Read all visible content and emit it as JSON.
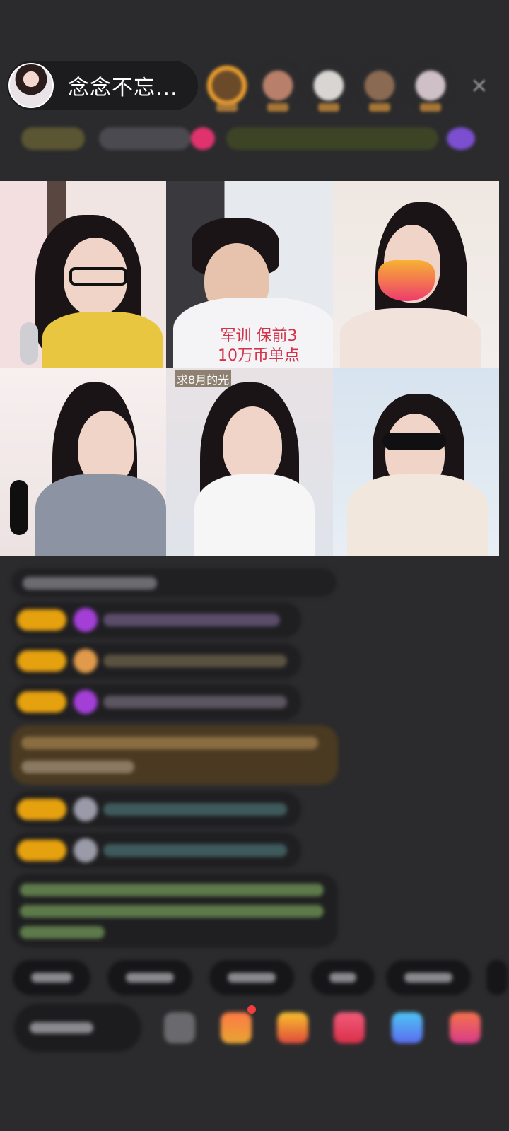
{
  "header": {
    "host_name": "念念不忘..."
  },
  "video_tiles": [
    {
      "overlay_lines": [
        "军训 保前3",
        "10万币单点"
      ]
    },
    {
      "name_tag": "求8月的光"
    }
  ],
  "icons": {
    "close": "close-icon",
    "gift": "gift-icon"
  },
  "colors": {
    "background": "#2b2b2d",
    "level_badge": "#e6a10f",
    "overlay_text": "#d4314a"
  }
}
